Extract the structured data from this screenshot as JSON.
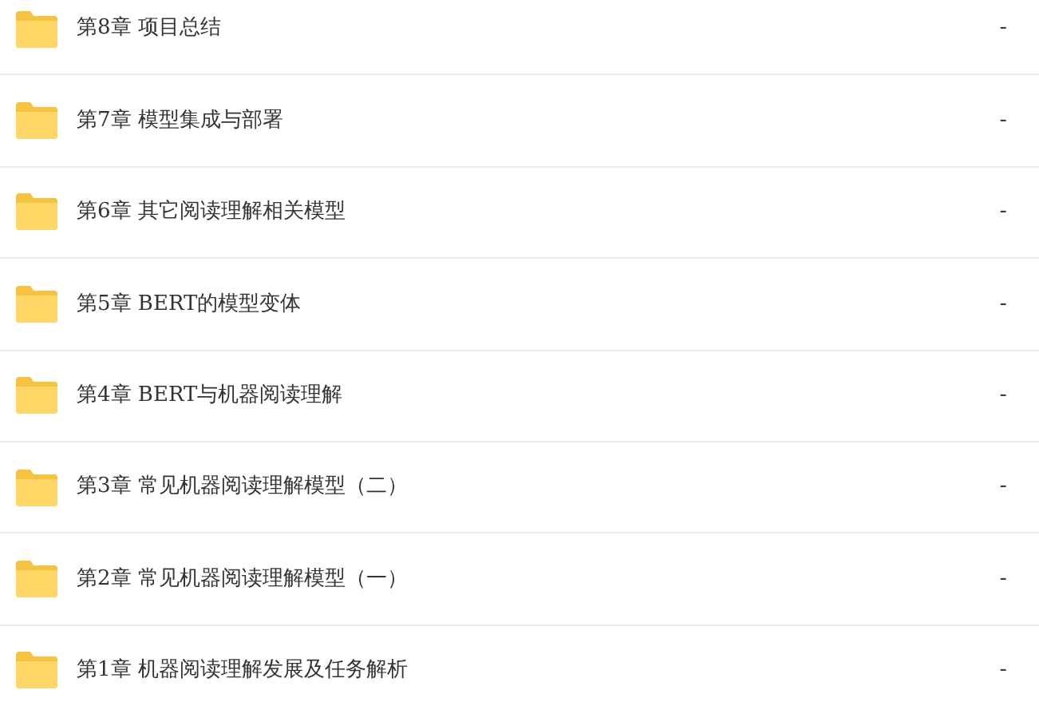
{
  "folders": [
    {
      "name": "第8章 项目总结",
      "size": "-"
    },
    {
      "name": "第7章 模型集成与部署",
      "size": "-"
    },
    {
      "name": "第6章 其它阅读理解相关模型",
      "size": "-"
    },
    {
      "name": "第5章 BERT的模型变体",
      "size": "-"
    },
    {
      "name": "第4章 BERT与机器阅读理解",
      "size": "-"
    },
    {
      "name": "第3章 常见机器阅读理解模型（二）",
      "size": "-"
    },
    {
      "name": "第2章 常见机器阅读理解模型（一）",
      "size": "-"
    },
    {
      "name": "第1章 机器阅读理解发展及任务解析",
      "size": "-"
    }
  ]
}
